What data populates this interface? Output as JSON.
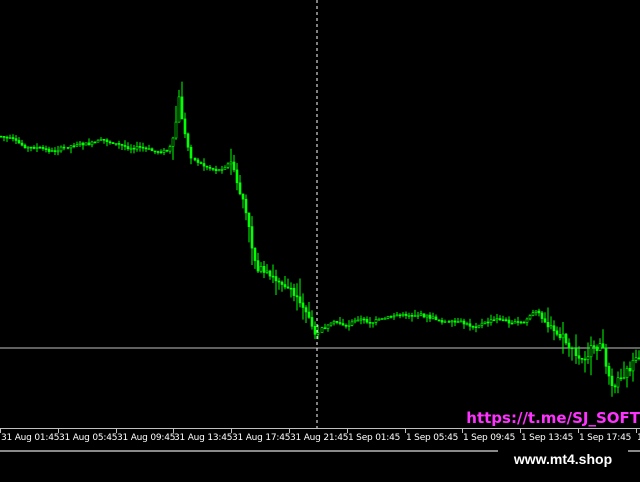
{
  "time_axis": {
    "labels": [
      "31 Aug 01:45",
      "31 Aug 05:45",
      "31 Aug 09:45",
      "31 Aug 13:45",
      "31 Aug 17:45",
      "31 Aug 21:45",
      "1 Sep 01:45",
      "1 Sep 05:45",
      "1 Sep 09:45",
      "1 Sep 13:45",
      "1 Sep 17:45",
      "1 Sep"
    ]
  },
  "overlay": {
    "telegram_text": "https://t.me/SJ_SOFT",
    "watermark_text": "www.mt4.shop"
  },
  "colors": {
    "background": "#000000",
    "candle": "#00ff00",
    "crosshair": "#ffffff",
    "hline": "#bfbfbf",
    "telegram": "#ff33ff"
  },
  "chart_data": {
    "type": "candlestick",
    "crosshair": "vertical dashed line at 31 Aug 21:45",
    "horizontal_line": "present",
    "series": [
      {
        "values": [
          [
            0.0,
            0.72
          ],
          [
            0.02,
            0.71
          ],
          [
            0.04,
            0.69
          ],
          [
            0.06,
            0.69
          ],
          [
            0.08,
            0.68
          ],
          [
            0.1,
            0.69
          ],
          [
            0.12,
            0.7
          ],
          [
            0.14,
            0.7
          ],
          [
            0.16,
            0.71
          ],
          [
            0.18,
            0.7
          ],
          [
            0.2,
            0.69
          ],
          [
            0.22,
            0.69
          ],
          [
            0.24,
            0.68
          ],
          [
            0.26,
            0.68
          ],
          [
            0.27,
            0.7
          ],
          [
            0.28,
            0.82
          ],
          [
            0.29,
            0.71
          ],
          [
            0.3,
            0.66
          ],
          [
            0.32,
            0.64
          ],
          [
            0.34,
            0.63
          ],
          [
            0.36,
            0.65
          ],
          [
            0.37,
            0.59
          ],
          [
            0.38,
            0.55
          ],
          [
            0.39,
            0.46
          ],
          [
            0.4,
            0.38
          ],
          [
            0.41,
            0.36
          ],
          [
            0.42,
            0.35
          ],
          [
            0.44,
            0.34
          ],
          [
            0.45,
            0.32
          ],
          [
            0.46,
            0.3
          ],
          [
            0.47,
            0.29
          ],
          [
            0.48,
            0.26
          ],
          [
            0.49,
            0.2
          ],
          [
            0.5,
            0.21
          ],
          [
            0.51,
            0.22
          ],
          [
            0.52,
            0.23
          ],
          [
            0.53,
            0.23
          ],
          [
            0.54,
            0.22
          ],
          [
            0.55,
            0.23
          ],
          [
            0.56,
            0.24
          ],
          [
            0.58,
            0.23
          ],
          [
            0.6,
            0.24
          ],
          [
            0.62,
            0.25
          ],
          [
            0.64,
            0.25
          ],
          [
            0.66,
            0.25
          ],
          [
            0.68,
            0.24
          ],
          [
            0.7,
            0.23
          ],
          [
            0.72,
            0.23
          ],
          [
            0.74,
            0.22
          ],
          [
            0.76,
            0.23
          ],
          [
            0.78,
            0.24
          ],
          [
            0.8,
            0.23
          ],
          [
            0.82,
            0.23
          ],
          [
            0.83,
            0.25
          ],
          [
            0.84,
            0.26
          ],
          [
            0.85,
            0.24
          ],
          [
            0.86,
            0.22
          ],
          [
            0.87,
            0.2
          ],
          [
            0.88,
            0.19
          ],
          [
            0.89,
            0.17
          ],
          [
            0.9,
            0.14
          ],
          [
            0.91,
            0.13
          ],
          [
            0.92,
            0.15
          ],
          [
            0.93,
            0.16
          ],
          [
            0.94,
            0.17
          ],
          [
            0.95,
            0.11
          ],
          [
            0.96,
            0.06
          ],
          [
            0.97,
            0.09
          ],
          [
            0.98,
            0.1
          ],
          [
            0.99,
            0.12
          ],
          [
            1.0,
            0.13
          ]
        ]
      }
    ]
  }
}
